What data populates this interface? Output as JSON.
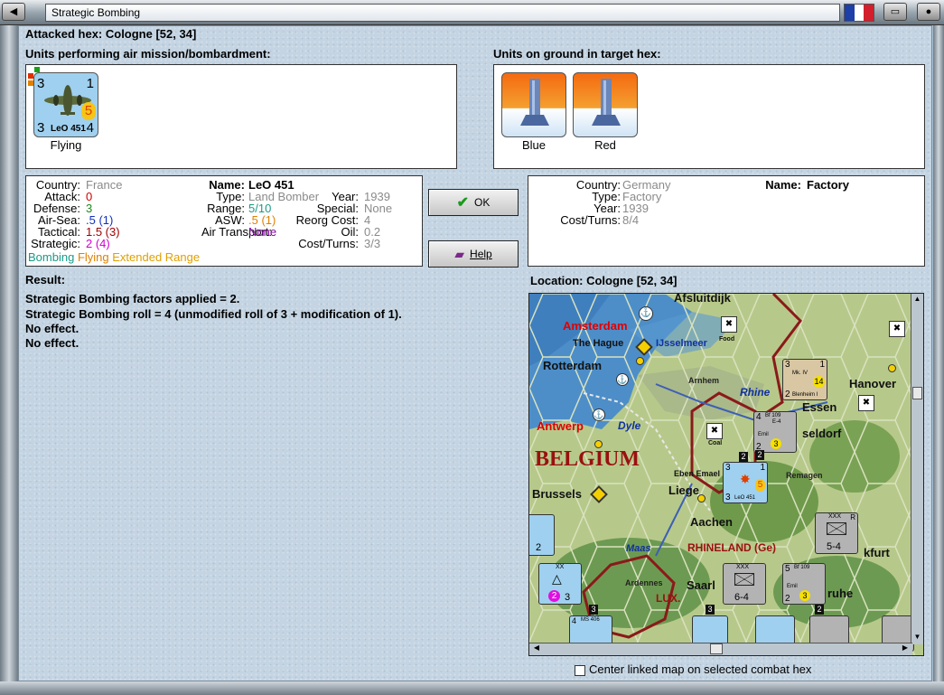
{
  "window": {
    "title": "Strategic Bombing",
    "flag_colors": [
      "#1c3fa8",
      "#ffffff",
      "#d21f2b"
    ]
  },
  "header": {
    "attacked_hex": "Attacked hex: Cologne  [52, 34]",
    "air_units_title": "Units performing air mission/bombardment:",
    "ground_units_title": "Units on ground in target hex:"
  },
  "air_unit": {
    "top_left": "3",
    "top_right": "1",
    "bottom_left": "3",
    "bottom_right": "4",
    "badge": "5",
    "name": "LeO 451",
    "caption": "Flying"
  },
  "ground_units": [
    {
      "caption": "Blue"
    },
    {
      "caption": "Red"
    }
  ],
  "attacker_stats": {
    "country_label": "Country:",
    "country": "France",
    "attack_label": "Attack:",
    "attack": "0",
    "defense_label": "Defense:",
    "defense": "3",
    "airsea_label": "Air-Sea:",
    "airsea": ".5 (1)",
    "tactical_label": "Tactical:",
    "tactical": "1.5 (3)",
    "strategic_label": "Strategic:",
    "strategic": "2 (4)",
    "name_label": "Name:",
    "name": "LeO 451",
    "type_label": "Type:",
    "type": "Land Bomber",
    "range_label": "Range:",
    "range": "5/10",
    "asw_label": "ASW:",
    "asw": ".5 (1)",
    "air_transport_label": "Air Transport:",
    "air_transport": "None",
    "year_label": "Year:",
    "year": "1939",
    "special_label": "Special:",
    "special": "None",
    "reorg_label": "Reorg Cost:",
    "reorg": "4",
    "oil_label": "Oil:",
    "oil": "0.2",
    "cost_label": "Cost/Turns:",
    "cost": "3/3",
    "tag_bombing": "Bombing",
    "tag_flying": "Flying",
    "tag_extended": "Extended Range"
  },
  "buttons": {
    "ok": "OK",
    "help": "Help"
  },
  "target_stats": {
    "country_label": "Country:",
    "country": "Germany",
    "type_label": "Type:",
    "type": "Factory",
    "year_label": "Year:",
    "year": "1939",
    "cost_label": "Cost/Turns:",
    "cost": "8/4",
    "name_label": "Name:",
    "name": "Factory"
  },
  "result": {
    "title": "Result:",
    "lines": [
      "Strategic Bombing factors applied = 2.",
      "Strategic Bombing roll = 4 (unmodified roll of 3 + modification of 1).",
      "No effect.",
      "No effect."
    ]
  },
  "location": {
    "title": "Location:  Cologne  [52, 34]"
  },
  "map": {
    "labels": {
      "afsluitdijk": "Afsluitdijk",
      "amsterdam": "Amsterdam",
      "the_hague": "The Hague",
      "ijsselmeer": "IJsselmeer",
      "rotterdam": "Rotterdam",
      "arnhem": "Arnhem",
      "rhine": "Rhine",
      "hanover": "Hanover",
      "essen": "Essen",
      "antwerp": "Antwerp",
      "dyle": "Dyle",
      "dusseldorf": "seldorf",
      "belgium": "BELGIUM",
      "eben_emael": "Eben Emael",
      "remagen": "Remagen",
      "brussels": "Brussels",
      "liege": "Liege",
      "aachen": "Aachen",
      "maas": "Maas",
      "rhineland": "RHINELAND (Ge)",
      "frankfurt": "kfurt",
      "ardennes": "Ardennes",
      "saarl": "Saarl",
      "lux": "LUX.",
      "ruhe": "ruhe",
      "food": "Food",
      "coal": "Coal"
    },
    "counters": {
      "blenheim": {
        "name": "Blenheim I",
        "top": "3",
        "top_right": "1",
        "bottom": "2",
        "badge": "14",
        "model": "Mk. IV"
      },
      "bf109_a": {
        "name": "Emil",
        "model": "Bf 109",
        "sub": "E-4",
        "top": "4",
        "bottom": "2",
        "badge": "3"
      },
      "leo": {
        "name": "LeO 451",
        "top": "3",
        "top_right": "1",
        "bottom": "3",
        "badge": "5"
      },
      "inf_5_4": {
        "size": "XXX",
        "value": "5-4",
        "side": "R"
      },
      "inf_6_4": {
        "size": "XXX",
        "value": "6-4"
      },
      "bf109_b": {
        "name": "Emil",
        "model": "Bf 109",
        "top": "5",
        "bottom": "2",
        "badge": "3"
      },
      "belgian_a": {
        "value": "2"
      },
      "belgian_b": {
        "size": "XX",
        "value": "3",
        "badge": "2"
      },
      "ms406": {
        "name": "MS 406",
        "top": "4"
      }
    },
    "stack_numbers": [
      "2",
      "2",
      "3",
      "3",
      "2"
    ]
  },
  "footer": {
    "center_map_label": "Center linked map on selected combat hex"
  }
}
